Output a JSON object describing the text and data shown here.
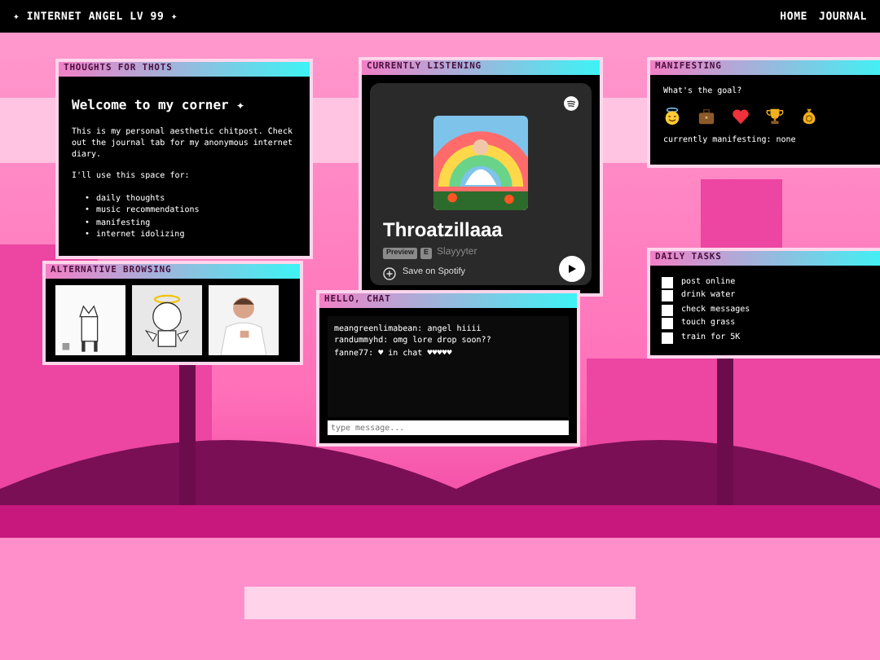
{
  "topbar": {
    "title": "✦ INTERNET ANGEL LV 99 ✦",
    "nav": [
      {
        "label": "HOME"
      },
      {
        "label": "JOURNAL"
      }
    ]
  },
  "windows": [
    {
      "kind": "notes",
      "title": "THOUGHTS FOR THOTS",
      "heading": "Welcome to my corner ✦",
      "paragraphs": [
        "This is my personal aesthetic chitpost. Check out the journal tab for my anonymous internet diary.",
        "I'll use this space for:"
      ],
      "bullets": [
        {
          "marker": "•",
          "text": "daily thoughts"
        },
        {
          "marker": "•",
          "text": "music recommendations"
        },
        {
          "marker": "•",
          "text": "manifesting"
        },
        {
          "marker": "•",
          "text": "internet idolizing"
        }
      ]
    },
    {
      "kind": "player",
      "title": "CURRENTLY LISTENING",
      "track": "Throatzillaaa",
      "badges": [
        "Preview",
        "E"
      ],
      "artist": "Slayyyter",
      "save": "Save on Spotify"
    },
    {
      "kind": "manifest",
      "title": "MANIFESTING",
      "question": "What's the goal?",
      "status": "currently manifesting: none"
    },
    {
      "kind": "tasks",
      "title": "DAILY TASKS",
      "tasks": [
        {
          "label": "post online",
          "checked": false
        },
        {
          "label": "drink water",
          "checked": false
        },
        {
          "label": "check messages",
          "checked": false
        },
        {
          "label": "touch grass",
          "checked": false
        },
        {
          "label": "train for 5K",
          "checked": false
        }
      ]
    },
    {
      "kind": "gallery",
      "title": "ALTERNATIVE BROWSING"
    },
    {
      "kind": "chat",
      "title": "HELLO, CHAT",
      "messages": [
        "meangreenlimabean: angel hiiii",
        "randummyhd: omg lore drop soon??",
        "fanne77: ♥ in chat ♥♥♥♥♥"
      ],
      "input": {
        "placeholder": "type message..."
      }
    }
  ]
}
